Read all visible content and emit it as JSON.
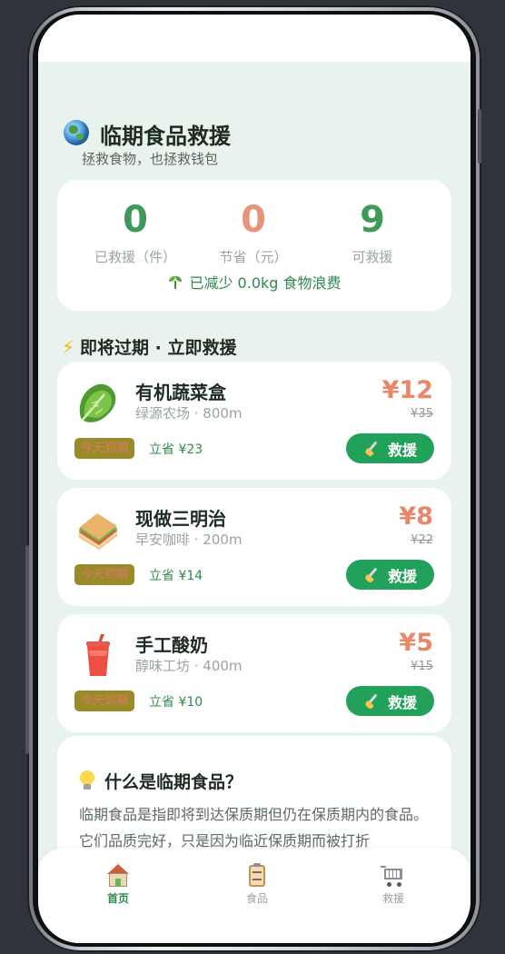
{
  "header": {
    "title": "临期食品救援",
    "subtitle": "拯救食物，也拯救钱包",
    "icon": "globe-icon"
  },
  "stats": {
    "rescued": {
      "value": "0",
      "label": "已救援（件）",
      "color": "#3f9a5a"
    },
    "saved": {
      "value": "0",
      "label": "节省（元）",
      "color": "#e8947a"
    },
    "available": {
      "value": "9",
      "label": "可救援",
      "color": "#3f9a5a"
    },
    "waste_text": "已减少 0.0kg 食物浪费"
  },
  "section": {
    "title": "即将过期 · 立即救援"
  },
  "products": [
    {
      "emoji": "🥬",
      "icon": "lettuce-icon",
      "name": "有机蔬菜盒",
      "meta": "绿源农场 · 800m",
      "price": "¥12",
      "original_price": "¥35",
      "badge": "今天到期",
      "savings": "立省 ¥23",
      "button": "救援"
    },
    {
      "emoji": "🥪",
      "icon": "sandwich-icon",
      "name": "现做三明治",
      "meta": "早安咖啡 · 200m",
      "price": "¥8",
      "original_price": "¥22",
      "badge": "今天到期",
      "savings": "立省 ¥14",
      "button": "救援"
    },
    {
      "emoji": "🥤",
      "icon": "yogurt-cup-icon",
      "name": "手工酸奶",
      "meta": "醇味工坊 · 400m",
      "price": "¥5",
      "original_price": "¥15",
      "badge": "今天到期",
      "savings": "立省 ¥10",
      "button": "救援"
    }
  ],
  "info": {
    "title": "什么是临期食品？",
    "text": "临期食品是指即将到达保质期但仍在保质期内的食品。它们品质完好，只是因为临近保质期而被打折"
  },
  "nav": {
    "home": "首页",
    "food": "食品",
    "rescue": "救援"
  }
}
